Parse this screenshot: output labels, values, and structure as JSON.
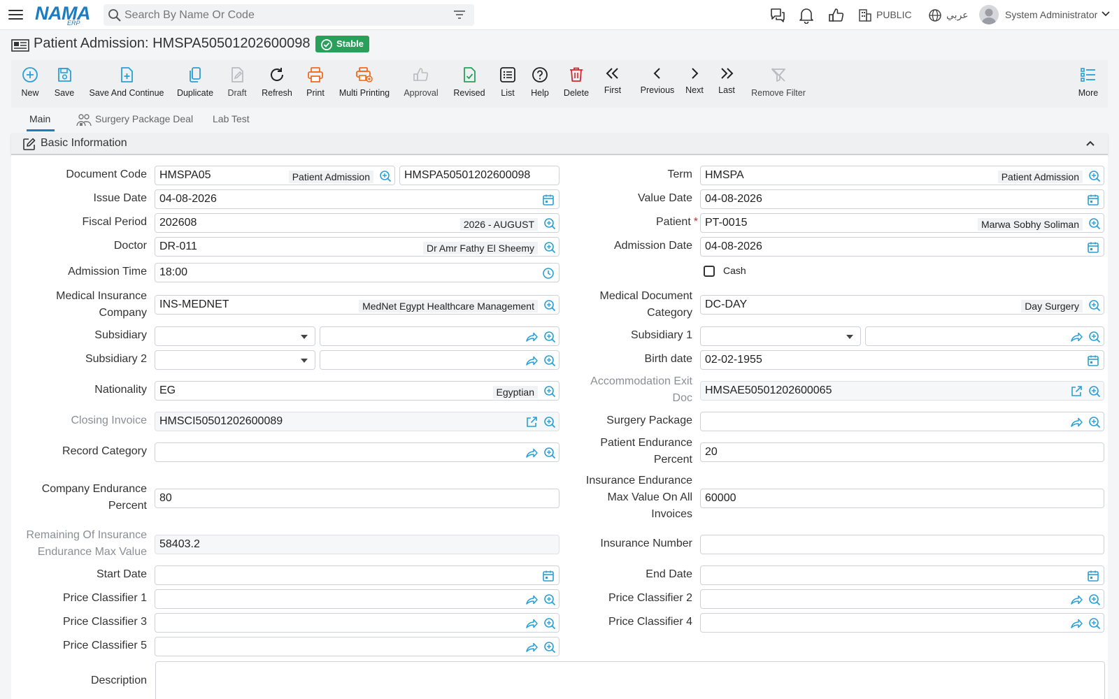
{
  "header": {
    "logo_text": "NAMA",
    "logo_sub": "ERP",
    "search_placeholder": "Search By Name Or Code",
    "branch": "PUBLIC",
    "language": "عربي",
    "user_name": "System Administrator"
  },
  "page": {
    "title": "Patient Admission: HMSPA50501202600098",
    "status": "Stable"
  },
  "toolbar": [
    {
      "id": "new",
      "label": "New",
      "icon": "plus-circle-icon"
    },
    {
      "id": "save",
      "label": "Save",
      "icon": "save-icon"
    },
    {
      "id": "save_continue",
      "label": "Save And Continue",
      "icon": "file-plus-icon"
    },
    {
      "id": "duplicate",
      "label": "Duplicate",
      "icon": "copy-icon"
    },
    {
      "id": "draft",
      "label": "Draft",
      "icon": "draft-icon"
    },
    {
      "id": "refresh",
      "label": "Refresh",
      "icon": "refresh-icon"
    },
    {
      "id": "print",
      "label": "Print",
      "icon": "printer-icon"
    },
    {
      "id": "multi_print",
      "label": "Multi Printing",
      "icon": "multi-printer-icon"
    },
    {
      "id": "approval",
      "label": "Approval",
      "icon": "thumbs-up-icon"
    },
    {
      "id": "revised",
      "label": "Revised",
      "icon": "file-check-icon"
    },
    {
      "id": "list",
      "label": "List",
      "icon": "list-icon"
    },
    {
      "id": "help",
      "label": "Help",
      "icon": "help-icon"
    },
    {
      "id": "delete",
      "label": "Delete",
      "icon": "trash-icon"
    },
    {
      "id": "first",
      "label": "First",
      "icon": "chevrons-left-icon"
    },
    {
      "id": "previous",
      "label": "Previous",
      "icon": "chevron-left-icon"
    },
    {
      "id": "next",
      "label": "Next",
      "icon": "chevron-right-icon"
    },
    {
      "id": "last",
      "label": "Last",
      "icon": "chevrons-right-icon"
    },
    {
      "id": "remove_filter",
      "label": "Remove Filter",
      "icon": "filter-off-icon"
    },
    {
      "id": "more",
      "label": "More",
      "icon": "more-list-icon"
    }
  ],
  "tabs": [
    "Main",
    "Surgery Package Deal",
    "Lab Test"
  ],
  "section": {
    "title": "Basic Information"
  },
  "form": {
    "document_code": {
      "label": "Document Code",
      "value": "HMSPA05",
      "desc": "Patient Admission",
      "code": "HMSPA50501202600098"
    },
    "term": {
      "label": "Term",
      "value": "HMSPA",
      "desc": "Patient Admission"
    },
    "issue_date": {
      "label": "Issue Date",
      "value": "04-08-2026"
    },
    "value_date": {
      "label": "Value Date",
      "value": "04-08-2026"
    },
    "fiscal_period": {
      "label": "Fiscal Period",
      "value": "202608",
      "desc": "2026 - AUGUST"
    },
    "patient": {
      "label": "Patient",
      "required": "*",
      "value": "PT-0015",
      "desc": "Marwa Sobhy Soliman"
    },
    "doctor": {
      "label": "Doctor",
      "value": "DR-011",
      "desc": "Dr Amr Fathy El Sheemy"
    },
    "admission_date": {
      "label": "Admission Date",
      "value": "04-08-2026"
    },
    "admission_time": {
      "label": "Admission Time",
      "value": "18:00"
    },
    "cash": {
      "label": "Cash"
    },
    "medical_insurance_company": {
      "label1": "Medical Insurance",
      "label2": "Company",
      "value": "INS-MEDNET",
      "desc": "MedNet Egypt Healthcare Management"
    },
    "medical_document_category": {
      "label1": "Medical Document",
      "label2": "Category",
      "value": "DC-DAY",
      "desc": "Day Surgery"
    },
    "subsidiary": {
      "label": "Subsidiary"
    },
    "subsidiary_1": {
      "label": "Subsidiary 1"
    },
    "subsidiary_2": {
      "label": "Subsidiary 2"
    },
    "birth_date": {
      "label": "Birth date",
      "value": "02-02-1955"
    },
    "nationality": {
      "label": "Nationality",
      "value": "EG",
      "desc": "Egyptian"
    },
    "accommodation_exit_doc": {
      "label1": "Accommodation Exit",
      "label2": "Doc",
      "value": "HMSAE50501202600065"
    },
    "closing_invoice": {
      "label": "Closing Invoice",
      "value": "HMSCI50501202600089"
    },
    "surgery_package": {
      "label": "Surgery Package"
    },
    "record_category": {
      "label": "Record Category"
    },
    "patient_endurance_percent": {
      "label1": "Patient Endurance",
      "label2": "Percent",
      "value": "20"
    },
    "company_endurance_percent": {
      "label1": "Company Endurance",
      "label2": "Percent",
      "value": "80"
    },
    "insurance_endurance_max": {
      "label1": "Insurance Endurance",
      "label2": "Max Value On All",
      "label3": "Invoices",
      "value": "60000"
    },
    "remaining_insurance": {
      "label1": "Remaining Of Insurance",
      "label2": "Endurance Max Value",
      "value": "58403.2"
    },
    "insurance_number": {
      "label": "Insurance Number"
    },
    "start_date": {
      "label": "Start Date"
    },
    "end_date": {
      "label": "End Date"
    },
    "price_classifier_1": {
      "label": "Price Classifier 1"
    },
    "price_classifier_2": {
      "label": "Price Classifier 2"
    },
    "price_classifier_3": {
      "label": "Price Classifier 3"
    },
    "price_classifier_4": {
      "label": "Price Classifier 4"
    },
    "price_classifier_5": {
      "label": "Price Classifier 5"
    },
    "description": {
      "label": "Description"
    }
  },
  "colors": {
    "brand": "#1b7cc4",
    "accent": "#2a9fd6",
    "status": "#28a05a",
    "danger": "#d9262c",
    "print": "#f26b1d"
  }
}
